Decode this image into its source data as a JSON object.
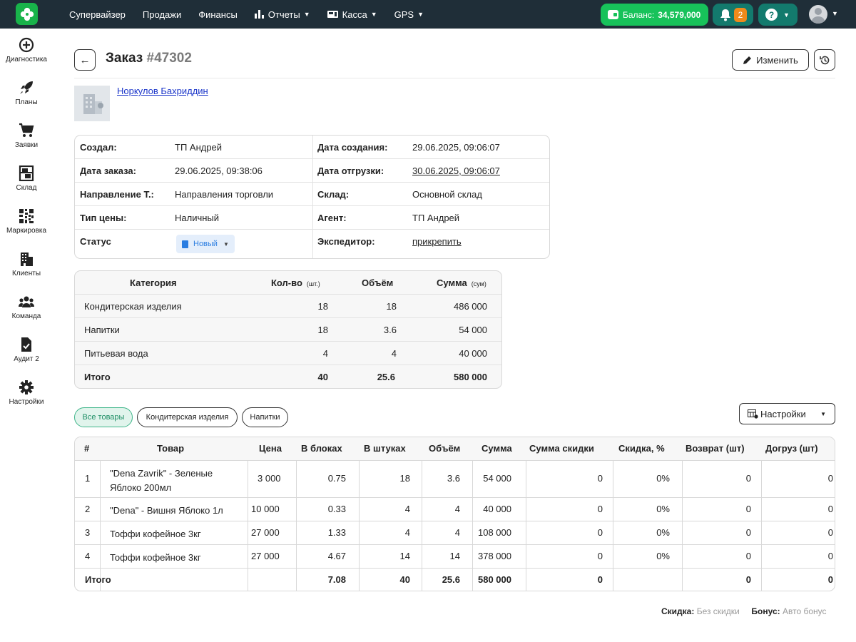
{
  "nav": {
    "items": [
      {
        "label": "Супервайзер",
        "icon": ""
      },
      {
        "label": "Продажи",
        "icon": ""
      },
      {
        "label": "Финансы",
        "icon": ""
      },
      {
        "label": "Отчеты",
        "icon": "bar-chart-icon",
        "dropdown": true
      },
      {
        "label": "Касса",
        "icon": "cash-register-icon",
        "dropdown": true
      },
      {
        "label": "GPS",
        "icon": "",
        "dropdown": true
      }
    ],
    "balance_label": "Баланс:",
    "balance_value": "34,579,000",
    "notifications_count": "2",
    "help_icon": "?"
  },
  "sidebar": {
    "items": [
      {
        "label": "Диагностика",
        "icon": "diagnostics-icon"
      },
      {
        "label": "Планы",
        "icon": "rocket-icon"
      },
      {
        "label": "Заявки",
        "icon": "cart-icon"
      },
      {
        "label": "Склад",
        "icon": "warehouse-icon"
      },
      {
        "label": "Маркировка",
        "icon": "qr-code-icon"
      },
      {
        "label": "Клиенты",
        "icon": "building-icon"
      },
      {
        "label": "Команда",
        "icon": "team-icon"
      },
      {
        "label": "Аудит 2",
        "icon": "audit-icon"
      },
      {
        "label": "Настройки",
        "icon": "gear-icon"
      }
    ]
  },
  "header": {
    "title": "Заказ",
    "order_number": "#47302",
    "edit_label": "Изменить"
  },
  "client": {
    "name": "Норкулов Бахриддин"
  },
  "info": {
    "left": [
      {
        "label": "Создал:",
        "value": "ТП Андрей"
      },
      {
        "label": "Дата заказа:",
        "value": "29.06.2025, 09:38:06"
      },
      {
        "label": "Направление Т.:",
        "value": "Направления торговли"
      },
      {
        "label": "Тип цены:",
        "value": "Наличный"
      },
      {
        "label": "Статус",
        "value": "Новый"
      }
    ],
    "right": [
      {
        "label": "Дата создания:",
        "value": "29.06.2025, 09:06:07"
      },
      {
        "label": "Дата отгрузки:",
        "value": "30.06.2025, 09:06:07"
      },
      {
        "label": "Склад:",
        "value": "Основной склад"
      },
      {
        "label": "Агент:",
        "value": "ТП Андрей"
      },
      {
        "label": "Экспедитор:",
        "value": "прикрепить"
      }
    ]
  },
  "categories": {
    "headers": {
      "category": "Категория",
      "qty": "Кол-во",
      "qty_unit": "(шт.)",
      "volume": "Объём",
      "sum": "Сумма",
      "sum_unit": "(сум)"
    },
    "rows": [
      {
        "name": "Кондитерская изделия",
        "qty": "18",
        "volume": "18",
        "sum": "486 000"
      },
      {
        "name": "Напитки",
        "qty": "18",
        "volume": "3.6",
        "sum": "54 000"
      },
      {
        "name": "Питьевая вода",
        "qty": "4",
        "volume": "4",
        "sum": "40 000"
      }
    ],
    "total": {
      "name": "Итого",
      "qty": "40",
      "volume": "25.6",
      "sum": "580 000"
    }
  },
  "filters": {
    "chips": [
      "Все товары",
      "Кондитерская изделия",
      "Напитки"
    ],
    "active": "Все товары",
    "settings_label": "Настройки"
  },
  "goods": {
    "headers": [
      "#",
      "Товар",
      "Цена",
      "В блоках",
      "В штуках",
      "Объём",
      "Сумма",
      "Сумма скидки",
      "Скидка, %",
      "Возврат (шт)",
      "Догруз (шт)"
    ],
    "rows": [
      {
        "n": "1",
        "name": "\"Dena Zavrik\" - Зеленые Яблоко 200мл",
        "price": "3 000",
        "blocks": "0.75",
        "pieces": "18",
        "volume": "3.6",
        "sum": "54 000",
        "discount_sum": "0",
        "discount_pct": "0%",
        "return": "0",
        "reload": "0"
      },
      {
        "n": "2",
        "name": "\"Dena\" - Вишня Яблоко 1л",
        "price": "10 000",
        "blocks": "0.33",
        "pieces": "4",
        "volume": "4",
        "sum": "40 000",
        "discount_sum": "0",
        "discount_pct": "0%",
        "return": "0",
        "reload": "0"
      },
      {
        "n": "3",
        "name": "Тоффи кофейное 3кг",
        "price": "27 000",
        "blocks": "1.33",
        "pieces": "4",
        "volume": "4",
        "sum": "108 000",
        "discount_sum": "0",
        "discount_pct": "0%",
        "return": "0",
        "reload": "0"
      },
      {
        "n": "4",
        "name": "Тоффи кофейное 3кг",
        "price": "27 000",
        "blocks": "4.67",
        "pieces": "14",
        "volume": "14",
        "sum": "378 000",
        "discount_sum": "0",
        "discount_pct": "0%",
        "return": "0",
        "reload": "0"
      }
    ],
    "total": {
      "label": "Итого",
      "blocks": "7.08",
      "pieces": "40",
      "volume": "25.6",
      "sum": "580 000",
      "discount_sum": "0",
      "return": "0",
      "reload": "0"
    }
  },
  "footer": {
    "discount_label": "Скидка:",
    "discount_value": "Без скидки",
    "bonus_label": "Бонус:",
    "bonus_value": "Авто бонус"
  },
  "colors": {
    "topbar": "#1f2e38",
    "accent_green": "#17c25a",
    "teal": "#137a6d",
    "badge_orange": "#ef8a1b",
    "link_blue": "#1a35c9"
  }
}
